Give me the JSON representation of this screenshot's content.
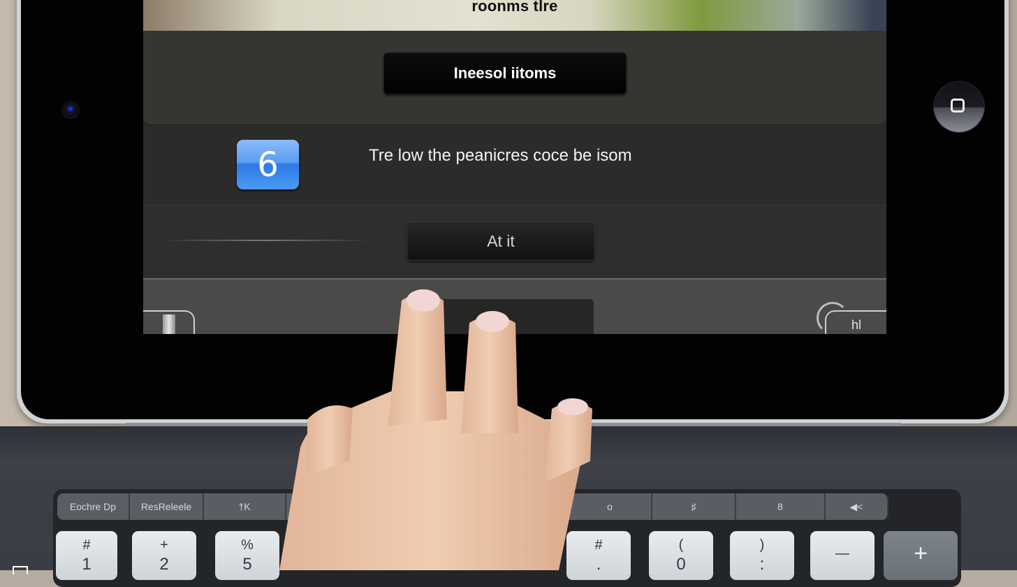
{
  "screen": {
    "banner_title": "roonms tlre",
    "primary_button": "Ineesol iitoms",
    "app_icon_glyph": "6",
    "message": "Tre low the peanicres coce be isom",
    "secondary_button": "At it",
    "toolbar_right_label": "hl"
  },
  "device": {
    "home_button_icon": "home-square-icon",
    "camera_icon": "front-camera-icon"
  },
  "keyboard": {
    "function_keys": [
      "Eochre Dp",
      "ResReleele",
      "†K",
      "",
      "",
      "o",
      "♯",
      "8",
      "◀<"
    ],
    "number_keys": [
      {
        "top": "#",
        "bottom": "1"
      },
      {
        "top": "+",
        "bottom": "2"
      },
      {
        "top": "%",
        "bottom": "5"
      },
      {
        "top": "#",
        "bottom": "."
      },
      {
        "top": "(",
        "bottom": "0"
      },
      {
        "top": ")",
        "bottom": ":"
      },
      {
        "top": "—",
        "bottom": ""
      },
      {
        "top": "+",
        "bottom": ""
      }
    ]
  },
  "colors": {
    "app_icon_blue": "#3f8cef",
    "screen_bg": "#2b2b2a",
    "bezel": "#020203"
  }
}
